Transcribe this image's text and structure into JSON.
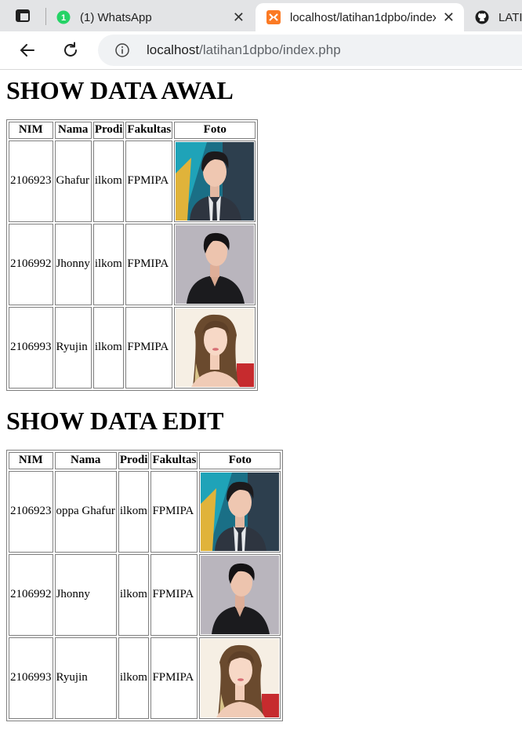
{
  "browser": {
    "tabs": [
      {
        "title": "(1) WhatsApp",
        "icon": "whatsapp-icon"
      },
      {
        "title": "localhost/latihan1dpbo/index",
        "icon": "xampp-icon",
        "active": true
      },
      {
        "title": "LATI",
        "icon": "github-icon"
      }
    ],
    "url_host": "localhost",
    "url_path": "/latihan1dpbo/index.php"
  },
  "sections": [
    {
      "heading": "SHOW DATA AWAL",
      "headers": [
        "NIM",
        "Nama",
        "Prodi",
        "Fakultas",
        "Foto"
      ],
      "rows": [
        {
          "nim": "2106923",
          "nama": "Ghafur",
          "prodi": "ilkom",
          "fakultas": "FPMIPA",
          "foto": "portrait-man-suit"
        },
        {
          "nim": "2106992",
          "nama": "Jhonny",
          "prodi": "ilkom",
          "fakultas": "FPMIPA",
          "foto": "portrait-man-black"
        },
        {
          "nim": "2106993",
          "nama": "Ryujin",
          "prodi": "ilkom",
          "fakultas": "FPMIPA",
          "foto": "portrait-woman"
        }
      ]
    },
    {
      "heading": "SHOW DATA EDIT",
      "headers": [
        "NIM",
        "Nama",
        "Prodi",
        "Fakultas",
        "Foto"
      ],
      "rows": [
        {
          "nim": "2106923",
          "nama": "oppa Ghafur",
          "prodi": "ilkom",
          "fakultas": "FPMIPA",
          "foto": "portrait-man-suit"
        },
        {
          "nim": "2106992",
          "nama": "Jhonny",
          "prodi": "ilkom",
          "fakultas": "FPMIPA",
          "foto": "portrait-man-black"
        },
        {
          "nim": "2106993",
          "nama": "Ryujin",
          "prodi": "ilkom",
          "fakultas": "FPMIPA",
          "foto": "portrait-woman"
        }
      ]
    }
  ]
}
